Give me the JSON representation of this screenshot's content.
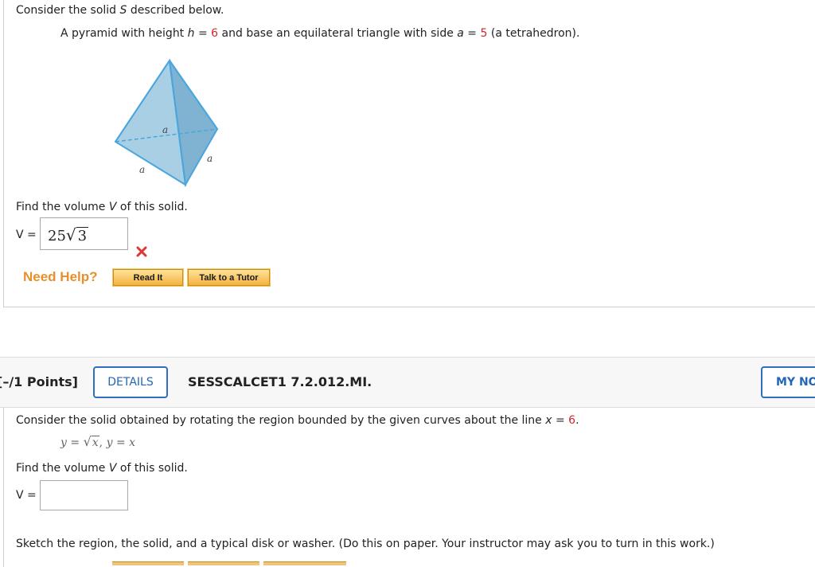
{
  "problem1": {
    "intro": "Consider the solid S described below.",
    "intro_parts": {
      "a": "Consider the solid ",
      "var": "S",
      "b": " described below."
    },
    "desc": {
      "p1": "A pyramid with height ",
      "h_var": "h",
      "eq1": " = ",
      "h_val": "6",
      "p2": " and base an equilateral triangle with side ",
      "a_var": "a",
      "eq2": " = ",
      "a_val": "5",
      "p3": " (a tetrahedron)."
    },
    "figure_labels": {
      "top": "a",
      "left": "a",
      "right": "a"
    },
    "find": {
      "a": "Find the volume ",
      "var": "V",
      "b": " of this solid."
    },
    "answer_label": "V =",
    "answer_value": {
      "coef": "25",
      "radicand": "3"
    },
    "answer_status": "incorrect",
    "need_help": "Need Help?",
    "read_it": "Read It",
    "talk_tutor": "Talk to a Tutor"
  },
  "problem2": {
    "points": "[–/1 Points]",
    "details": "DETAILS",
    "code": "SESSCALCET1 7.2.012.MI.",
    "my_notes": "MY NO",
    "q": {
      "a": "Consider the solid obtained by rotating the region bounded by the given curves about the line ",
      "var": "x",
      "eq": " = ",
      "val": "6",
      "end": "."
    },
    "curves": {
      "y1": "y",
      "eq1": " = ",
      "rad": "x",
      "sep": ",  ",
      "y2": "y",
      "eq2": " = ",
      "x2": "x"
    },
    "find": {
      "a": "Find the volume ",
      "var": "V",
      "b": " of this solid."
    },
    "answer_label": "V =",
    "answer_value": "",
    "sketch": "Sketch the region, the solid, and a typical disk or washer. (Do this on paper. Your instructor may ask you to turn in this work.)"
  },
  "colors": {
    "highlight": "#d0262b",
    "link": "#2266b8",
    "help": "#e8902b",
    "wrong": "#e0362f"
  }
}
